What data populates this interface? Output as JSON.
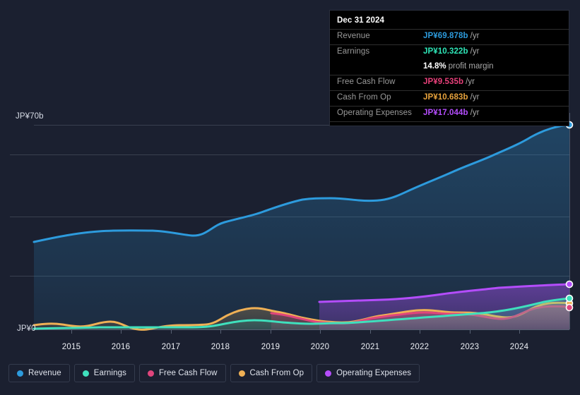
{
  "tooltip": {
    "title": "Dec 31 2024",
    "rows": [
      {
        "label": "Revenue",
        "value": "JP¥69.878b",
        "suffix": "/yr",
        "color": "#2d9bdd"
      },
      {
        "label": "Earnings",
        "value": "JP¥10.322b",
        "suffix": "/yr",
        "color": "#2ee6b8"
      },
      {
        "label": "",
        "value": "14.8%",
        "suffix": "profit margin",
        "color": "#ffffff"
      },
      {
        "label": "Free Cash Flow",
        "value": "JP¥9.535b",
        "suffix": "/yr",
        "color": "#e8407a"
      },
      {
        "label": "Cash From Op",
        "value": "JP¥10.683b",
        "suffix": "/yr",
        "color": "#e8a33d"
      },
      {
        "label": "Operating Expenses",
        "value": "JP¥17.044b",
        "suffix": "/yr",
        "color": "#b44dfc"
      }
    ]
  },
  "legend": {
    "items": [
      {
        "label": "Revenue",
        "color": "#2d9bdd"
      },
      {
        "label": "Earnings",
        "color": "#3fe0bd"
      },
      {
        "label": "Free Cash Flow",
        "color": "#e0457c"
      },
      {
        "label": "Cash From Op",
        "color": "#efb055"
      },
      {
        "label": "Operating Expenses",
        "color": "#b44dfc"
      }
    ]
  },
  "axes": {
    "y_top_label": "JP¥70b",
    "y_bottom_label": "JP¥0",
    "x_ticks": [
      "2015",
      "2016",
      "2017",
      "2018",
      "2019",
      "2020",
      "2021",
      "2022",
      "2023",
      "2024"
    ]
  },
  "chart_data": {
    "type": "area",
    "title": "",
    "subtitle": "",
    "xlabel": "",
    "ylabel": "JP¥ (billions)",
    "ylim": [
      0,
      70
    ],
    "xlim": [
      2014.3,
      2025.0
    ],
    "yticks": [
      0,
      70
    ],
    "ytick_labels": [
      "JP¥0",
      "JP¥70b"
    ],
    "gridlines_y": [
      0,
      17.5,
      35,
      52.5,
      70
    ],
    "grid": true,
    "legend_position": "bottom-left",
    "currency": "JP¥",
    "unit": "b",
    "period": "/yr",
    "highlight_date": "Dec 31 2024",
    "x": [
      2014.4,
      2015.0,
      2015.5,
      2016.0,
      2016.5,
      2017.0,
      2017.5,
      2018.0,
      2018.5,
      2019.0,
      2019.5,
      2020.0,
      2020.5,
      2021.0,
      2021.5,
      2022.0,
      2022.5,
      2023.0,
      2023.5,
      2024.0,
      2024.5,
      2024.95
    ],
    "series": [
      {
        "name": "Revenue",
        "color": "#2d9bdd",
        "fill": "rgba(45,155,221,0.16)",
        "values": [
          21.0,
          23.2,
          24.3,
          24.6,
          24.9,
          24.0,
          24.4,
          26.6,
          28.4,
          30.6,
          33.6,
          35.2,
          35.4,
          35.6,
          38.0,
          41.8,
          45.6,
          49.4,
          53.4,
          58.0,
          64.4,
          69.878
        ],
        "end_value": 69.878,
        "end_label": "JP¥69.878b"
      },
      {
        "name": "Earnings",
        "color": "#3fe0bd",
        "fill": "rgba(63,224,189,0.16)",
        "values": [
          0.7,
          0.9,
          1.0,
          1.1,
          1.0,
          1.1,
          1.3,
          1.9,
          2.6,
          2.9,
          2.7,
          2.8,
          3.0,
          3.1,
          3.2,
          3.6,
          4.0,
          4.4,
          4.9,
          5.7,
          7.6,
          10.322
        ],
        "end_value": 10.322,
        "end_label": "JP¥10.322b"
      },
      {
        "name": "Free Cash Flow",
        "color": "#e0457c",
        "fill": "rgba(224,69,124,0.18)",
        "start_x": 2018.9,
        "values": [
          null,
          null,
          null,
          null,
          null,
          null,
          null,
          null,
          null,
          5.6,
          4.9,
          3.9,
          3.4,
          3.0,
          3.4,
          4.2,
          5.0,
          5.4,
          5.2,
          5.1,
          7.2,
          9.535
        ],
        "end_value": 9.535,
        "end_label": "JP¥9.535b"
      },
      {
        "name": "Cash From Op",
        "color": "#efb055",
        "fill": "rgba(239,176,85,0.16)",
        "values": [
          1.4,
          1.7,
          1.3,
          1.9,
          1.0,
          1.7,
          1.8,
          2.6,
          4.9,
          5.8,
          5.0,
          4.3,
          3.8,
          3.4,
          3.9,
          4.8,
          5.7,
          6.2,
          5.9,
          5.8,
          8.0,
          10.683
        ],
        "end_value": 10.683,
        "end_label": "JP¥10.683b"
      },
      {
        "name": "Operating Expenses",
        "color": "#b44dfc",
        "fill": "rgba(180,77,252,0.22)",
        "start_x": 2019.95,
        "values": [
          null,
          null,
          null,
          null,
          null,
          null,
          null,
          null,
          null,
          null,
          null,
          10.5,
          10.6,
          10.7,
          11.1,
          11.7,
          12.4,
          13.1,
          13.9,
          14.8,
          15.9,
          17.044
        ],
        "end_value": 17.044,
        "end_label": "JP¥17.044b"
      }
    ],
    "annotations": [
      {
        "text": "14.8% profit margin",
        "target": "Earnings",
        "at_x": 2024.95
      }
    ]
  }
}
